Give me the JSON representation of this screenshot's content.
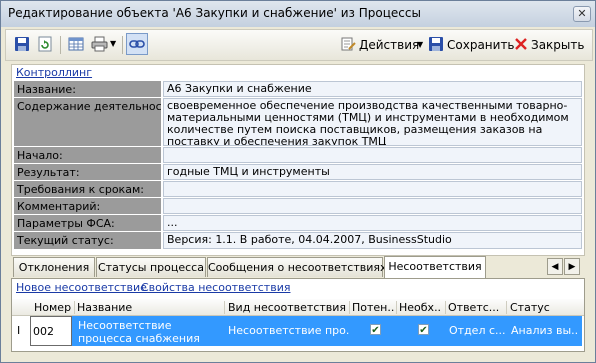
{
  "window": {
    "title": "Редактирование объекта 'А6 Закупки и снабжение' из Процессы",
    "close_glyph": "✕"
  },
  "toolbar": {
    "actions_label": "Действия",
    "save_label": "Сохранить",
    "close_label": "Закрыть"
  },
  "section_link": "Контроллинг",
  "fields": {
    "name": {
      "label": "Название:",
      "value": "А6 Закупки и снабжение"
    },
    "content": {
      "label": "Содержание деятельности:",
      "value": "своевременное обеспечение производства качественными товарно-материальными ценностями (ТМЦ) и инструментами в необходимом количестве путем поиска поставщиков, размещения заказов на поставку и обеспечения закупок ТМЦ"
    },
    "start": {
      "label": "Начало:",
      "value": ""
    },
    "result": {
      "label": "Результат:",
      "value": "годные ТМЦ и инструменты"
    },
    "deadlines": {
      "label": "Требования к срокам:",
      "value": ""
    },
    "comment": {
      "label": "Комментарий:",
      "value": ""
    },
    "fsa": {
      "label": "Параметры ФСА:",
      "value": "..."
    },
    "status": {
      "label": "Текущий статус:",
      "value": "Версия: 1.1. В работе, 04.04.2007, BusinessStudio"
    }
  },
  "tabs": [
    "Отклонения",
    "Статусы процесса",
    "Сообщения о несоответствиях",
    "Несоответствия"
  ],
  "active_tab": "Несоответствия",
  "lower_links": {
    "new": "Новое несоответствие",
    "props": "Свойства несоответствия"
  },
  "table": {
    "columns": [
      "Номер",
      "Название",
      "Вид несоответствия",
      "Потен...",
      "Необх...",
      "Ответс...",
      "Статус"
    ],
    "rows": [
      {
        "number": "002",
        "name": "Несоответствие процесса снабжения",
        "kind": "Несоответствие про...",
        "potential": true,
        "required": true,
        "responsible": "Отдел с...",
        "status": "Анализ вы..."
      }
    ]
  },
  "colors": {
    "selection": "#3399ff",
    "label_bg": "#9b9b9b",
    "link": "#1a3aa6"
  }
}
